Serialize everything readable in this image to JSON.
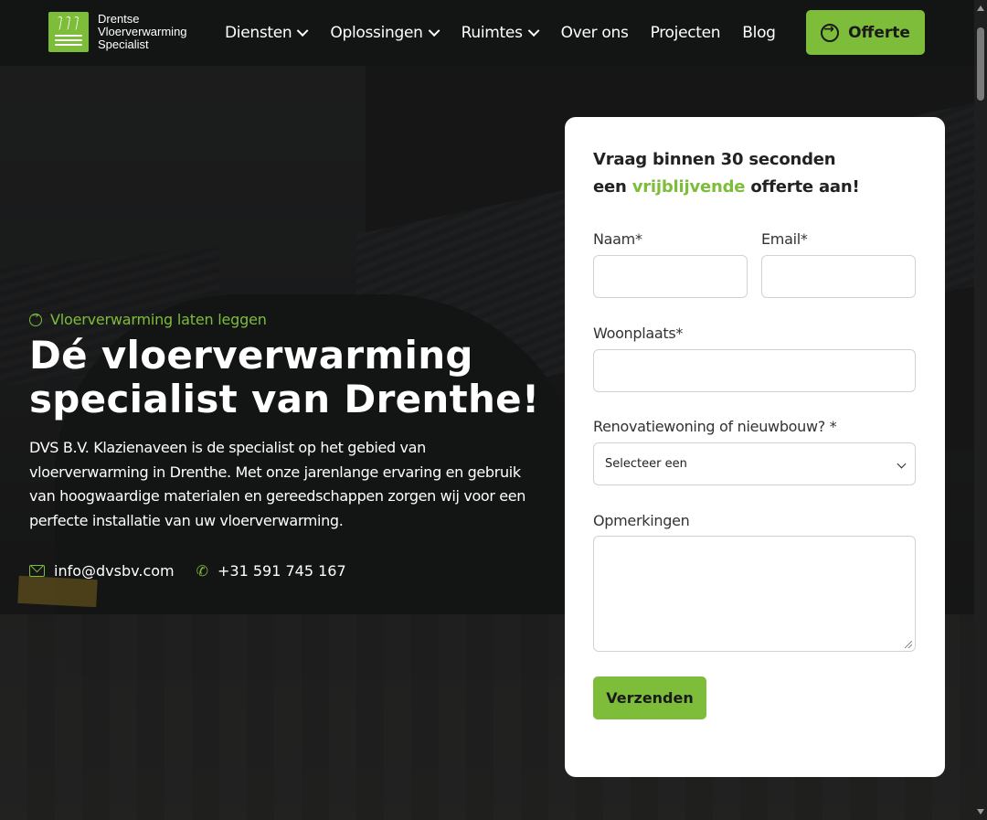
{
  "brand": {
    "logo_lines": [
      "Drentse",
      "Vloerverwarming",
      "Specialist"
    ],
    "accent_color": "#7dbd3a"
  },
  "nav": {
    "items": [
      {
        "label": "Diensten",
        "dropdown": true
      },
      {
        "label": "Oplossingen",
        "dropdown": true
      },
      {
        "label": "Ruimtes",
        "dropdown": true
      },
      {
        "label": "Over ons",
        "dropdown": false
      },
      {
        "label": "Projecten",
        "dropdown": false
      },
      {
        "label": "Blog",
        "dropdown": false
      }
    ],
    "cta_label": "Offerte"
  },
  "hero": {
    "tagline": "Vloerverwarming laten leggen",
    "headline_line1": "Dé vloerverwarming",
    "headline_line2": "specialist van Drenthe!",
    "intro": "DVS B.V. Klazienaveen is de specialist op het gebied van vloerverwarming in Drenthe. Met onze jarenlange ervaring en gebruik van hoogwaardige materialen en gereedschappen zorgen wij voor een perfecte installatie van uw vloerverwarming.",
    "email": "info@dvsbv.com",
    "phone": "+31 591 745 167"
  },
  "form": {
    "title_part1": "Vraag binnen 30 seconden",
    "title_part2_pre": "een ",
    "title_part2_accent": "vrijblijvende",
    "title_part2_post": " offerte aan!",
    "name_label": "Naam*",
    "name_value": "",
    "email_label": "Email*",
    "email_value": "",
    "city_label": "Woonplaats*",
    "city_value": "",
    "type_label": "Renovatiewoning of nieuwbouw? *",
    "type_selected": "Selecteer een",
    "remarks_label": "Opmerkingen",
    "remarks_value": "",
    "submit_label": "Verzenden"
  }
}
